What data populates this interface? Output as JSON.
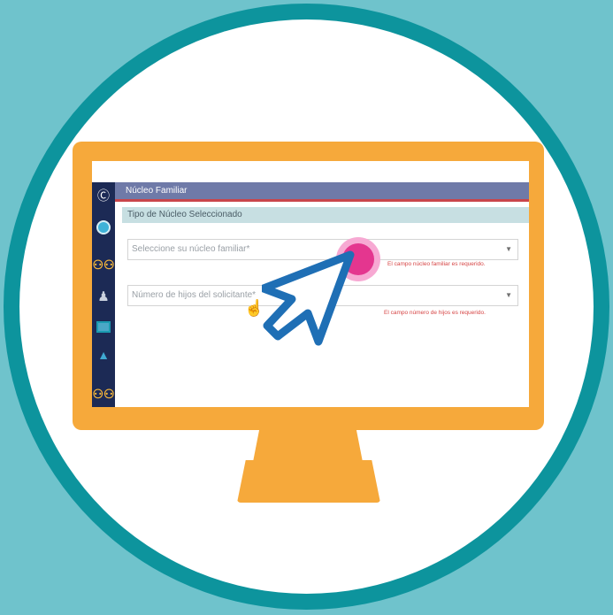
{
  "window": {
    "title": "Núcleo Familiar"
  },
  "section": {
    "title": "Tipo de Núcleo Seleccionado"
  },
  "form": {
    "family_select": {
      "placeholder": "Seleccione su núcleo familiar*",
      "error": "El campo núcleo familiar es requerido."
    },
    "children_select": {
      "placeholder": "Número de hijos del solicitante*",
      "error": "El campo número de hijos es requerido."
    }
  },
  "sidebar": {
    "icons": [
      "collapse-icon",
      "user-icon",
      "family-icon",
      "group-icon",
      "id-card-icon",
      "graduation-cap-icon",
      "family-icon"
    ]
  },
  "colors": {
    "background": "#6fc3cc",
    "ring": "#0d949d",
    "monitor": "#f6a93b",
    "titlebar": "#6f7aa8",
    "accent_red": "#c9454b",
    "click_marker": "#e4368f",
    "pointer": "#1f6fb5"
  }
}
